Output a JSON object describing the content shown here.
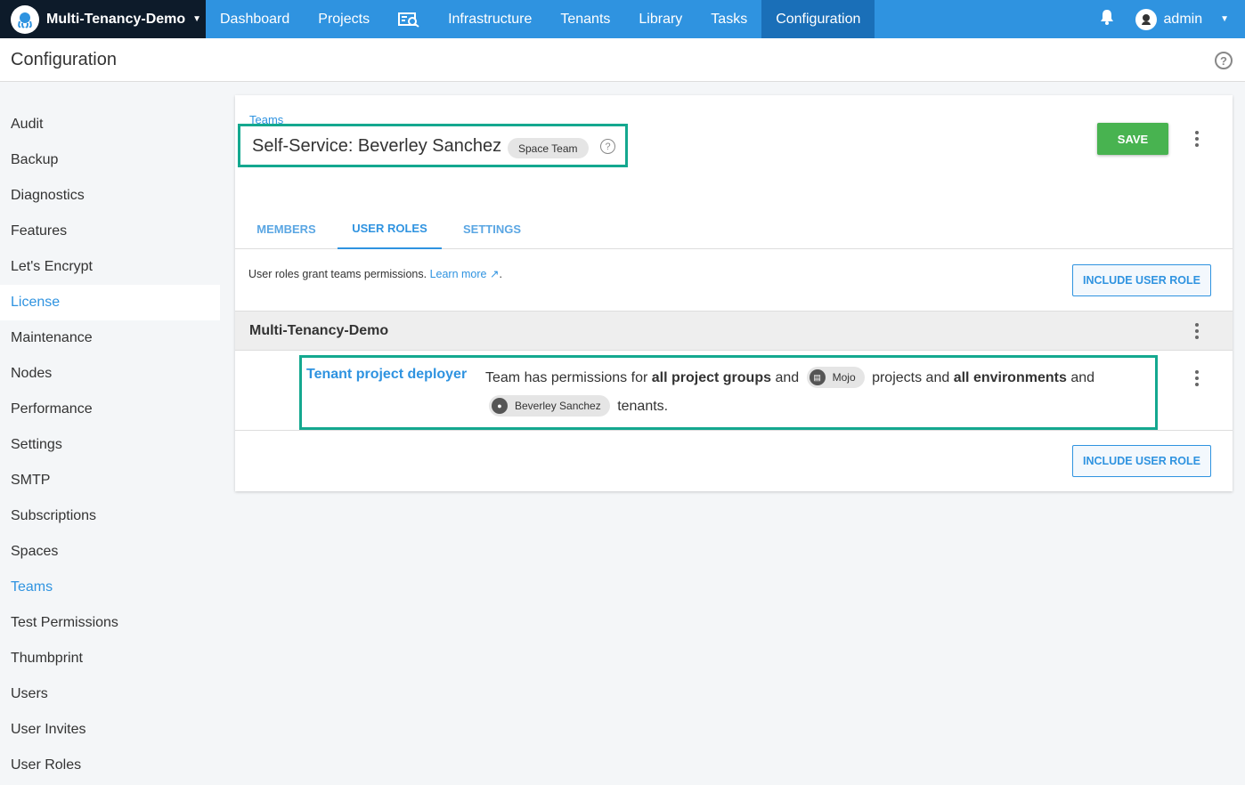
{
  "nav": {
    "space_name": "Multi-Tenancy-Demo",
    "items": [
      {
        "label": "Dashboard"
      },
      {
        "label": "Projects"
      },
      {
        "label": "Infrastructure"
      },
      {
        "label": "Tenants"
      },
      {
        "label": "Library"
      },
      {
        "label": "Tasks"
      },
      {
        "label": "Configuration"
      }
    ],
    "user": "admin"
  },
  "page": {
    "title": "Configuration"
  },
  "sidebar": {
    "items": [
      {
        "label": "Audit"
      },
      {
        "label": "Backup"
      },
      {
        "label": "Diagnostics"
      },
      {
        "label": "Features"
      },
      {
        "label": "Let's Encrypt"
      },
      {
        "label": "License"
      },
      {
        "label": "Maintenance"
      },
      {
        "label": "Nodes"
      },
      {
        "label": "Performance"
      },
      {
        "label": "Settings"
      },
      {
        "label": "SMTP"
      },
      {
        "label": "Subscriptions"
      },
      {
        "label": "Spaces"
      },
      {
        "label": "Teams"
      },
      {
        "label": "Test Permissions"
      },
      {
        "label": "Thumbprint"
      },
      {
        "label": "Users"
      },
      {
        "label": "User Invites"
      },
      {
        "label": "User Roles"
      }
    ]
  },
  "team": {
    "breadcrumb": "Teams",
    "title": "Self-Service: Beverley Sanchez",
    "badge": "Space Team",
    "save_label": "SAVE",
    "tabs": [
      {
        "label": "MEMBERS"
      },
      {
        "label": "USER ROLES"
      },
      {
        "label": "SETTINGS"
      }
    ],
    "intro_text": "User roles grant teams permissions.",
    "learn_more": "Learn more",
    "include_label": "INCLUDE USER ROLE",
    "group_name": "Multi-Tenancy-Demo",
    "role": {
      "name": "Tenant project deployer",
      "desc_1": "Team has permissions for",
      "bold_1": "all project groups",
      "and_1": "and",
      "project_chip": "Mojo",
      "desc_2": "projects and",
      "bold_2": "all environments",
      "and_2": "and",
      "tenant_chip": "Beverley Sanchez",
      "desc_3": "tenants."
    }
  },
  "colors": {
    "nav_blue": "#2f93e0",
    "nav_dark": "#0d1b2a",
    "save_green": "#48b350",
    "highlight": "#14a88f"
  }
}
